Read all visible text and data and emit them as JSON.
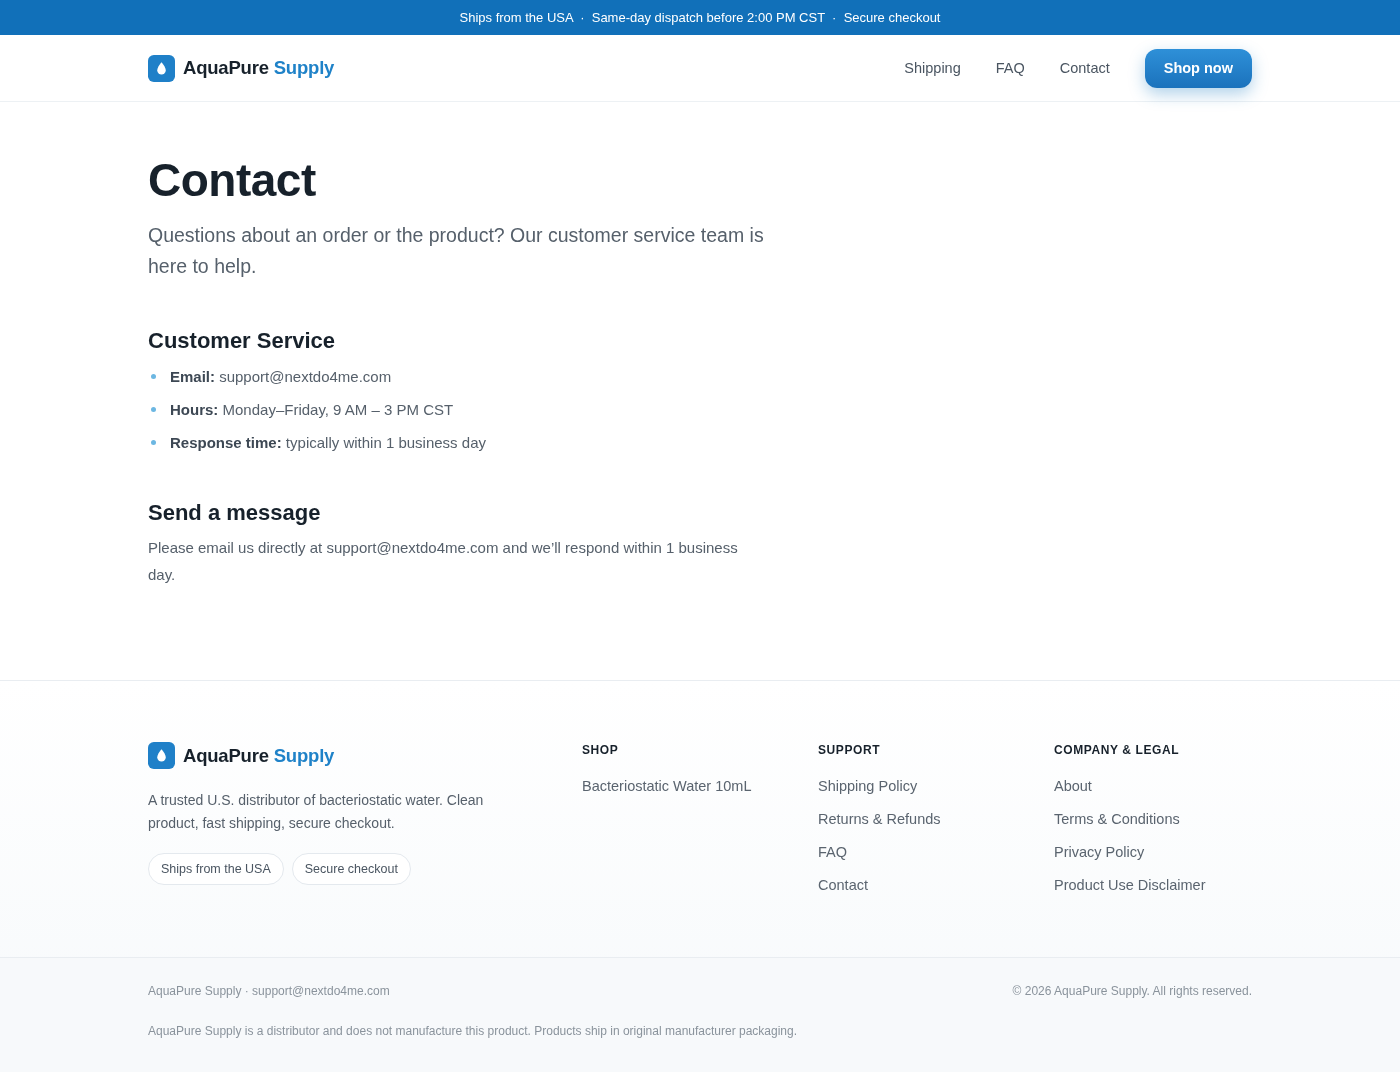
{
  "announcement_bar": {
    "text": "Ships from the USA  ·  Same-day dispatch before 2:00 PM CST  ·  Secure checkout"
  },
  "header": {
    "logo": {
      "name": "AquaPure",
      "accent": "Supply"
    },
    "nav": [
      "Shipping",
      "FAQ",
      "Contact"
    ],
    "cta": "Shop now"
  },
  "page": {
    "title": "Contact",
    "intro": "Questions about an order or the product? Our customer service team is here to help.",
    "sections": [
      {
        "kind": "list",
        "heading": "Customer Service",
        "items": [
          "**Email:** support@nextdo4me.com",
          "**Hours:** Monday–Friday, 9 AM – 3 PM CST",
          "**Response time:** typically within 1 business day"
        ]
      },
      {
        "kind": "paragraph",
        "heading": "Send a message",
        "text": "Please email us directly at support@nextdo4me.com and we’ll respond within 1 business day."
      }
    ]
  },
  "footer": {
    "logo": {
      "name": "AquaPure",
      "accent": "Supply"
    },
    "description": "A trusted U.S. distributor of bacteriostatic water. Clean product, fast shipping, secure checkout.",
    "badges": [
      "Ships from the USA",
      "Secure checkout"
    ],
    "columns": [
      {
        "heading": "SHOP",
        "links": [
          "Bacteriostatic Water 10mL"
        ]
      },
      {
        "heading": "SUPPORT",
        "links": [
          "Shipping Policy",
          "Returns & Refunds",
          "FAQ",
          "Contact"
        ]
      },
      {
        "heading": "COMPANY & LEGAL",
        "links": [
          "About",
          "Terms & Conditions",
          "Privacy Policy",
          "Product Use Disclaimer"
        ]
      }
    ],
    "bottom": {
      "contact": "AquaPure Supply · support@nextdo4me.com",
      "copyright": "© 2026 AquaPure Supply. All rights reserved.",
      "disclaimer": "AquaPure Supply is a distributor and does not manufacture this product. Products ship in original manufacturer packaging."
    }
  }
}
